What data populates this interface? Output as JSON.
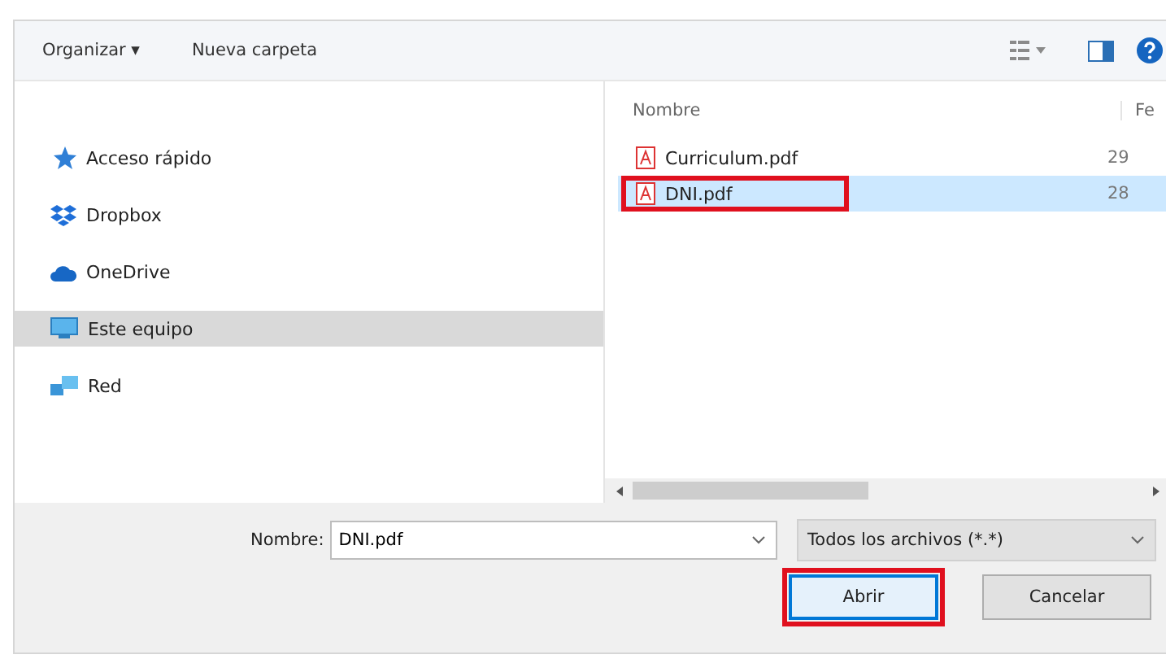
{
  "toolbar": {
    "organize": "Organizar ▾",
    "new_folder": "Nueva carpeta"
  },
  "sidebar": {
    "items": [
      {
        "label": "Acceso rápido",
        "kind": "star",
        "selected": false
      },
      {
        "label": "Dropbox",
        "kind": "dropbox",
        "selected": false
      },
      {
        "label": "OneDrive",
        "kind": "cloud",
        "selected": false
      },
      {
        "label": "Este equipo",
        "kind": "computer",
        "selected": true
      },
      {
        "label": "Red",
        "kind": "network",
        "selected": false
      }
    ]
  },
  "file_list": {
    "columns": [
      "Nombre",
      "Fe"
    ],
    "rows": [
      {
        "name": "Curriculum.pdf",
        "column_2": "29",
        "selected": false,
        "highlighted": false
      },
      {
        "name": "DNI.pdf",
        "column_2": "28",
        "selected": true,
        "highlighted": true
      }
    ]
  },
  "footer": {
    "name_label": "Nombre:",
    "name_value": "DNI.pdf",
    "filter": "Todos los archivos (*.*)",
    "buttons": [
      {
        "label": "Abrir",
        "kind": "primary",
        "highlighted": true
      },
      {
        "label": "Cancelar",
        "kind": "secondary",
        "highlighted": false
      }
    ]
  }
}
